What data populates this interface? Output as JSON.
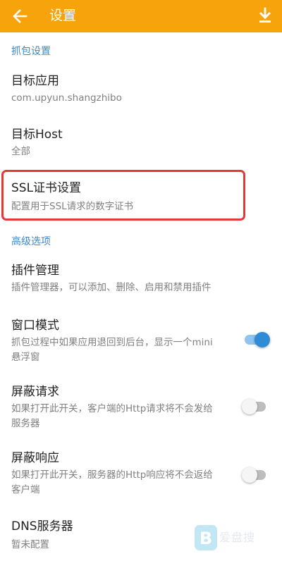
{
  "appbar": {
    "title": "设置",
    "back_icon": "arrow-left-icon",
    "download_icon": "download-icon",
    "background": "#f7a30c"
  },
  "sections": {
    "capture": "抓包设置",
    "advanced": "高级选项"
  },
  "items": {
    "target_app": {
      "title": "目标应用",
      "summary": "com.upyun.shangzhibo"
    },
    "target_host": {
      "title": "目标Host",
      "summary": "全部"
    },
    "ssl_cert": {
      "title": "SSL证书设置",
      "summary": "配置用于SSL请求的数字证书"
    },
    "plugin_mgmt": {
      "title": "插件管理",
      "summary": "插件管理器，可以添加、删除、启用和禁用插件"
    },
    "window_mode": {
      "title": "窗口模式",
      "summary_line1": "抓包过程中如果应用退回到后台，显示一个mini",
      "summary_line2": "悬浮窗",
      "switch_on": true
    },
    "block_request": {
      "title": "屏蔽请求",
      "summary_line1": "如果打开此开关，客户端的Http请求将不会发给",
      "summary_line2": "服务器",
      "switch_on": false
    },
    "block_response": {
      "title": "屏蔽响应",
      "summary_line1": "如果打开此开关，服务器的Http响应将不会返给",
      "summary_line2": "客户端",
      "switch_on": false
    },
    "dns_server": {
      "title": "DNS服务器",
      "summary": "暂未配置"
    }
  },
  "colors": {
    "accent_blue": "#3f87c6",
    "switch_on": "#2f8bd6",
    "highlight_border": "#e53935"
  },
  "watermark": {
    "text": "爱盘搜",
    "icon": "watermark-logo-icon"
  }
}
